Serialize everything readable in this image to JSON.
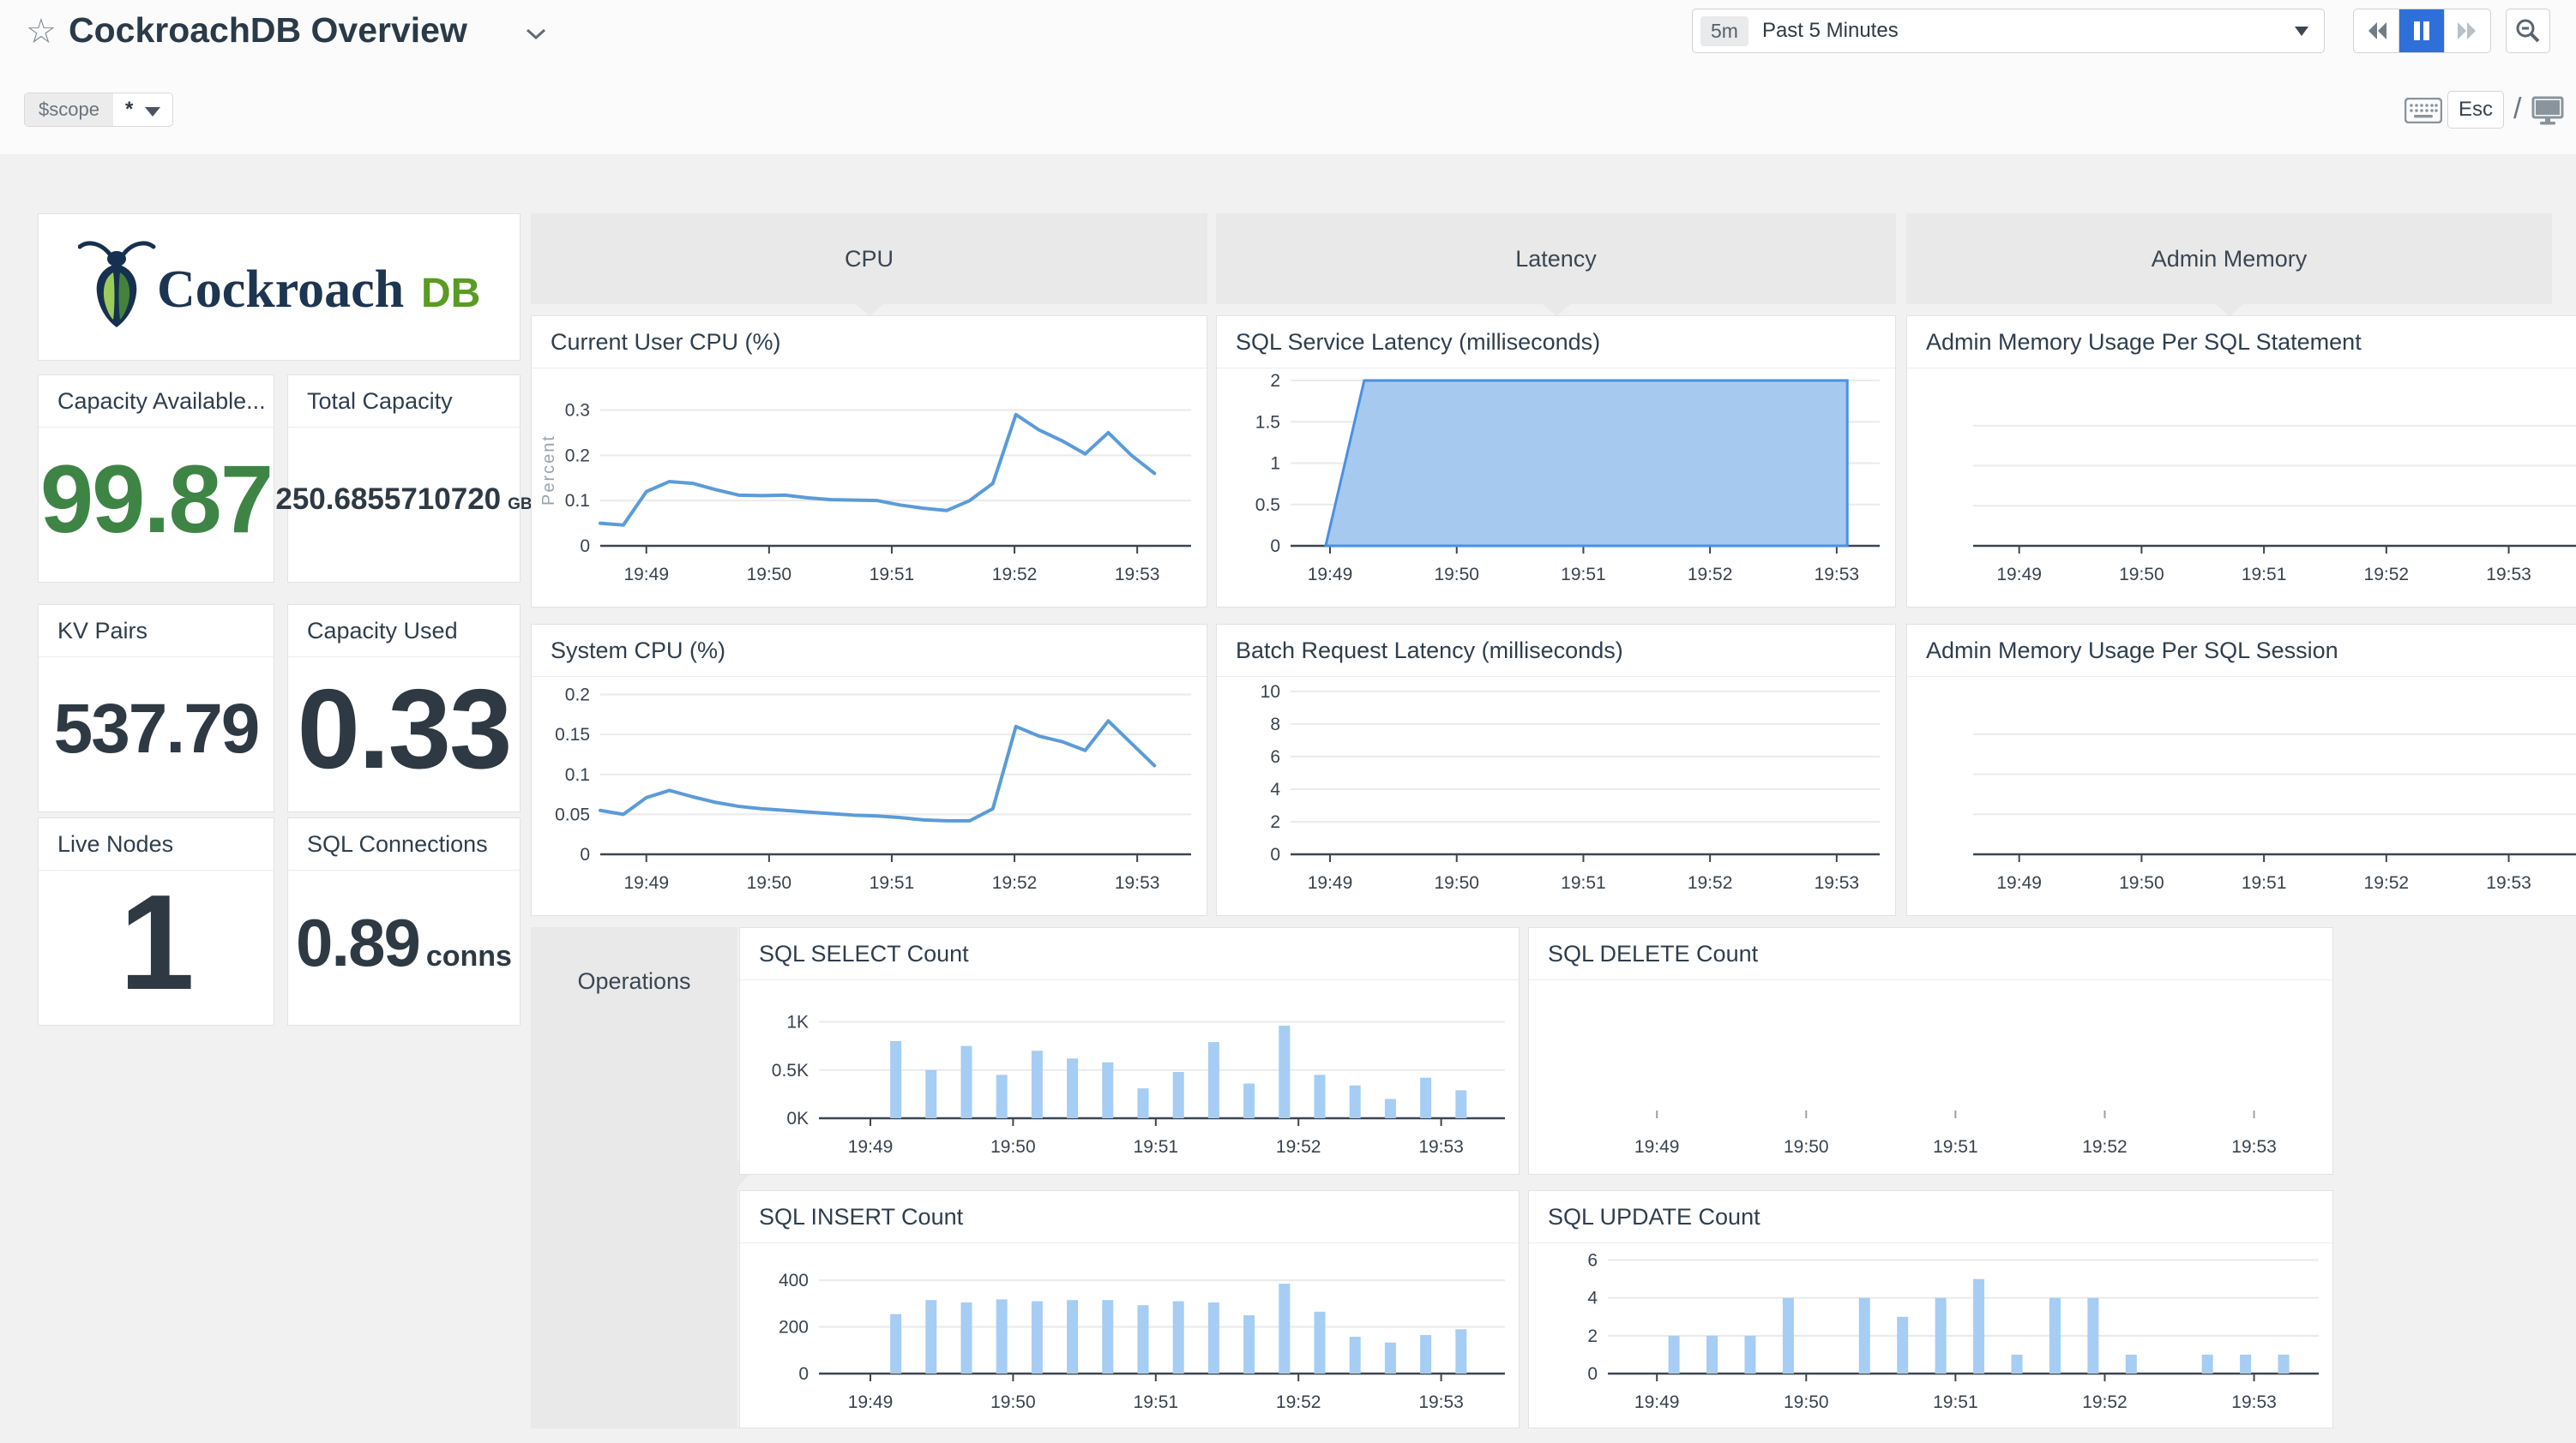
{
  "header": {
    "title": "CockroachDB Overview",
    "time_badge": "5m",
    "time_label": "Past 5 Minutes",
    "esc_label": "Esc",
    "slash": "/"
  },
  "scope": {
    "label": "$scope",
    "value": "*"
  },
  "logo": {
    "word": "Cockroach",
    "suffix": "DB"
  },
  "stats": {
    "capacity_available": {
      "label": "Capacity Available...",
      "value": "99.87"
    },
    "total_capacity": {
      "label": "Total Capacity",
      "value": "250.6855710720",
      "unit": "GB"
    },
    "kv_pairs": {
      "label": "KV Pairs",
      "value": "537.79"
    },
    "capacity_used": {
      "label": "Capacity Used",
      "value": "0.33"
    },
    "live_nodes": {
      "label": "Live Nodes",
      "value": "1"
    },
    "sql_connections": {
      "label": "SQL Connections",
      "value": "0.89",
      "unit": "conns"
    }
  },
  "groups": {
    "cpu": "CPU",
    "latency": "Latency",
    "admin": "Admin Memory",
    "operations": "Operations"
  },
  "x_ticks": [
    "19:49",
    "19:50",
    "19:51",
    "19:52",
    "19:53"
  ],
  "colors": {
    "chart_line": "#5b9bd8",
    "chart_area_fill": "#a6c9f0",
    "chart_area_stroke": "#4a90e2",
    "chart_bar": "#a6cdf3",
    "stat_green": "#3e8545",
    "accent_blue": "#2e6fd9"
  },
  "charts": {
    "current_user_cpu": {
      "title": "Current User CPU (%)",
      "type": "line",
      "ylabel": "Percent",
      "ymax": 0.335,
      "y_ticks": [
        {
          "v": 0,
          "label": "0"
        },
        {
          "v": 0.1,
          "label": "0.1"
        },
        {
          "v": 0.2,
          "label": "0.2"
        },
        {
          "v": 0.3,
          "label": "0.3"
        }
      ],
      "values": [
        0.05,
        0.046,
        0.12,
        0.142,
        0.138,
        0.124,
        0.112,
        0.111,
        0.112,
        0.106,
        0.102,
        0.101,
        0.1,
        0.09,
        0.083,
        0.078,
        0.1,
        0.138,
        0.29,
        0.256,
        0.232,
        0.203,
        0.25,
        0.2,
        0.16
      ]
    },
    "system_cpu": {
      "title": "System CPU (%)",
      "type": "line",
      "ymax": 0.207,
      "y_ticks": [
        {
          "v": 0,
          "label": "0"
        },
        {
          "v": 0.05,
          "label": "0.05"
        },
        {
          "v": 0.1,
          "label": "0.1"
        },
        {
          "v": 0.15,
          "label": "0.15"
        },
        {
          "v": 0.2,
          "label": "0.2"
        }
      ],
      "values": [
        0.055,
        0.05,
        0.071,
        0.08,
        0.072,
        0.065,
        0.06,
        0.057,
        0.055,
        0.053,
        0.051,
        0.049,
        0.048,
        0.046,
        0.043,
        0.042,
        0.042,
        0.057,
        0.16,
        0.148,
        0.141,
        0.13,
        0.167,
        0.139,
        0.111
      ]
    },
    "sql_service_latency": {
      "title": "SQL Service Latency (milliseconds)",
      "type": "area",
      "ymax": 2,
      "area_value": 2,
      "y_ticks": [
        {
          "v": 0,
          "label": "0"
        },
        {
          "v": 0.5,
          "label": "0.5"
        },
        {
          "v": 1,
          "label": "1"
        },
        {
          "v": 1.5,
          "label": "1.5"
        },
        {
          "v": 2,
          "label": "2"
        }
      ]
    },
    "batch_request_latency": {
      "title": "Batch Request Latency (milliseconds)",
      "type": "empty",
      "ymax": 10.15,
      "y_ticks": [
        {
          "v": 0,
          "label": "0"
        },
        {
          "v": 2,
          "label": "2"
        },
        {
          "v": 4,
          "label": "4"
        },
        {
          "v": 6,
          "label": "6"
        },
        {
          "v": 8,
          "label": "8"
        },
        {
          "v": 10,
          "label": "10"
        }
      ]
    },
    "admin_mem_statement": {
      "title": "Admin Memory Usage Per SQL Statement",
      "type": "admin",
      "ymax": 1
    },
    "admin_mem_session": {
      "title": "Admin Memory Usage Per SQL Session",
      "type": "admin",
      "ymax": 1
    },
    "sql_select": {
      "title": "SQL SELECT Count",
      "type": "bars",
      "ymax": 1200,
      "y_ticks": [
        {
          "v": 0,
          "label": "0K"
        },
        {
          "v": 500,
          "label": "0.5K"
        },
        {
          "v": 1000,
          "label": "1K"
        }
      ],
      "values": [
        800,
        500,
        750,
        450,
        700,
        620,
        580,
        310,
        480,
        790,
        360,
        960,
        450,
        340,
        200,
        420,
        290
      ]
    },
    "sql_delete": {
      "title": "SQL DELETE Count",
      "type": "bare",
      "ymax": 1
    },
    "sql_insert": {
      "title": "SQL INSERT Count",
      "type": "bars",
      "ymax": 470,
      "y_ticks": [
        {
          "v": 0,
          "label": "0"
        },
        {
          "v": 200,
          "label": "200"
        },
        {
          "v": 400,
          "label": "400"
        }
      ],
      "values": [
        255,
        315,
        305,
        318,
        310,
        315,
        315,
        293,
        310,
        305,
        250,
        385,
        265,
        158,
        133,
        165,
        190
      ]
    },
    "sql_update": {
      "title": "SQL UPDATE Count",
      "type": "bars",
      "ymax": 6.25,
      "y_ticks": [
        {
          "v": 0,
          "label": "0"
        },
        {
          "v": 2,
          "label": "2"
        },
        {
          "v": 4,
          "label": "4"
        },
        {
          "v": 6,
          "label": "6"
        }
      ],
      "values": [
        2,
        2,
        2,
        4,
        0,
        4,
        3,
        4,
        5,
        1,
        4,
        4,
        1,
        0,
        1,
        1,
        1
      ]
    }
  }
}
